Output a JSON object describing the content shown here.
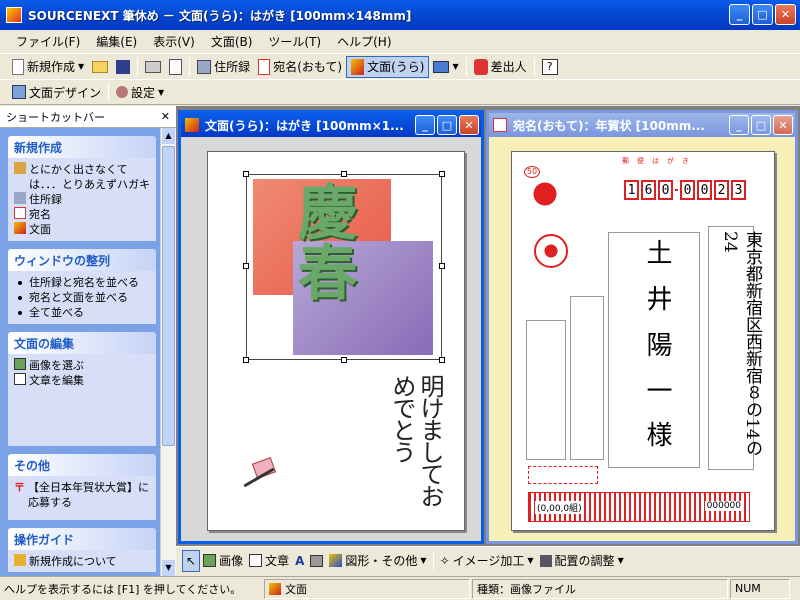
{
  "window": {
    "title": "SOURCENEXT 筆休め － 文面(うら)：はがき [100mm×148mm]"
  },
  "menu": [
    "ファイル(F)",
    "編集(E)",
    "表示(V)",
    "文面(B)",
    "ツール(T)",
    "ヘルプ(H)"
  ],
  "toolbar1": {
    "new": "新規作成",
    "address_book": "住所録",
    "address_side": "宛名(おもて)",
    "message_side": "文面(うら)",
    "sender": "差出人"
  },
  "toolbar2": {
    "design": "文面デザイン",
    "settings": "設定"
  },
  "sidebar": {
    "title": "ショートカットバー",
    "groups": [
      {
        "title": "新規作成",
        "items": [
          "とにかく出さなくては．．．とりあえずハガキ",
          "住所録",
          "宛名",
          "文面"
        ]
      },
      {
        "title": "ウィンドウの整列",
        "items": [
          "住所録と宛名を並べる",
          "宛名と文面を並べる",
          "全て並べる"
        ]
      },
      {
        "title": "文面の編集",
        "items": [
          "画像を選ぶ",
          "文章を編集"
        ]
      },
      {
        "title": "その他",
        "items": [
          "【全日本年賀状大賞】に応募する"
        ]
      },
      {
        "title": "操作ガイド",
        "items": [
          "新規作成について"
        ]
      }
    ]
  },
  "windows": {
    "front": {
      "title": "文面(うら)：はがき [100mm×1..."
    },
    "address": {
      "title": "宛名(おもて)：年賀状 [100mm..."
    }
  },
  "card_front": {
    "greeting_image": "慶春",
    "message": "明けましておめでとう"
  },
  "card_address": {
    "header": "郵便はがき",
    "stamp_value": "50",
    "zip": [
      "1",
      "6",
      "0",
      "0",
      "0",
      "2",
      "3"
    ],
    "recipient_name": "土井陽一",
    "honorific": "様",
    "recipient_address": "東京都新宿区西新宿８の14の24",
    "lottery_label": "(0,00,0組)",
    "lottery_number": "000000"
  },
  "drawbar": {
    "image": "画像",
    "text": "文章",
    "shapes": "図形・その他",
    "image_process": "イメージ加工",
    "layout": "配置の調整"
  },
  "statusbar": {
    "help": "ヘルプを表示するには [F1] を押してください。",
    "side": "文面",
    "kind": "種類：画像ファイル",
    "num": "NUM"
  },
  "colors": {
    "title_blue": "#0a5de9",
    "postal_red": "#e02020",
    "sidebar_blue": "#7ba2e7"
  }
}
